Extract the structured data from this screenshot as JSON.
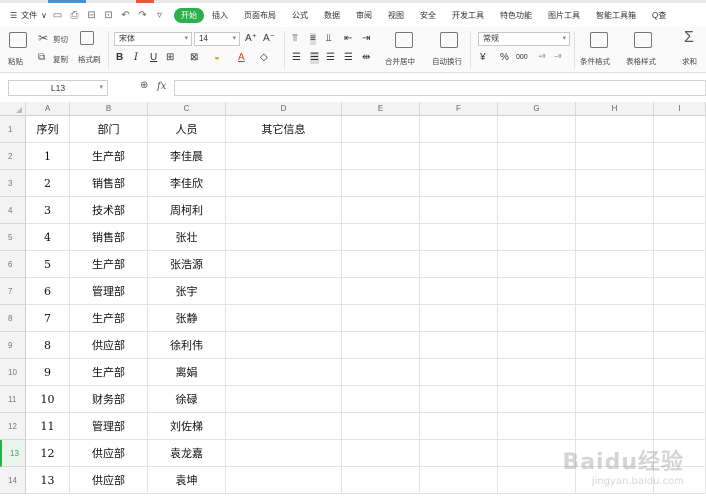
{
  "menu": {
    "file_label": "文件",
    "start_label": "开始",
    "tabs": [
      "插入",
      "页面布局",
      "公式",
      "数据",
      "审阅",
      "视图",
      "安全",
      "开发工具",
      "特色功能",
      "图片工具",
      "智能工具箱"
    ],
    "search_label": "Q查"
  },
  "ribbon": {
    "paste_label": "粘贴",
    "cut_label": "剪切",
    "copy_label": "复制",
    "format_painter_label": "格式刷",
    "font_name": "宋体",
    "font_size": "14",
    "merge_label": "合并居中",
    "wrap_label": "自动换行",
    "number_format": "常规",
    "percent_label": "%",
    "thousands_label": "000",
    "cond_format_label": "条件格式",
    "table_style_label": "表格样式",
    "sum_label": "求和"
  },
  "formula_bar": {
    "name_box": "L13",
    "fx_label": "fx",
    "formula": ""
  },
  "sheet": {
    "columns": [
      "A",
      "B",
      "C",
      "D",
      "E",
      "F",
      "G",
      "H",
      "I"
    ],
    "row_numbers": [
      "1",
      "2",
      "3",
      "4",
      "5",
      "6",
      "7",
      "8",
      "9",
      "10",
      "11",
      "12",
      "13",
      "14"
    ],
    "active_row": "13",
    "header": [
      "序列",
      "部门",
      "人员",
      "其它信息"
    ],
    "rows": [
      [
        "1",
        "生产部",
        "李佳晨"
      ],
      [
        "2",
        "销售部",
        "李佳欣"
      ],
      [
        "3",
        "技术部",
        "周柯利"
      ],
      [
        "4",
        "销售部",
        "张壮"
      ],
      [
        "5",
        "生产部",
        "张浩源"
      ],
      [
        "6",
        "管理部",
        "张宇"
      ],
      [
        "7",
        "生产部",
        "张静"
      ],
      [
        "8",
        "供应部",
        "徐利伟"
      ],
      [
        "9",
        "生产部",
        "离娟"
      ],
      [
        "10",
        "财务部",
        "徐碌"
      ],
      [
        "11",
        "管理部",
        "刘佐梯"
      ],
      [
        "12",
        "供应部",
        "袁龙嘉"
      ],
      [
        "13",
        "供应部",
        "袁坤"
      ]
    ]
  },
  "watermark": {
    "line1": "Baidu经验",
    "line2": "jingyan.baidu.com"
  }
}
